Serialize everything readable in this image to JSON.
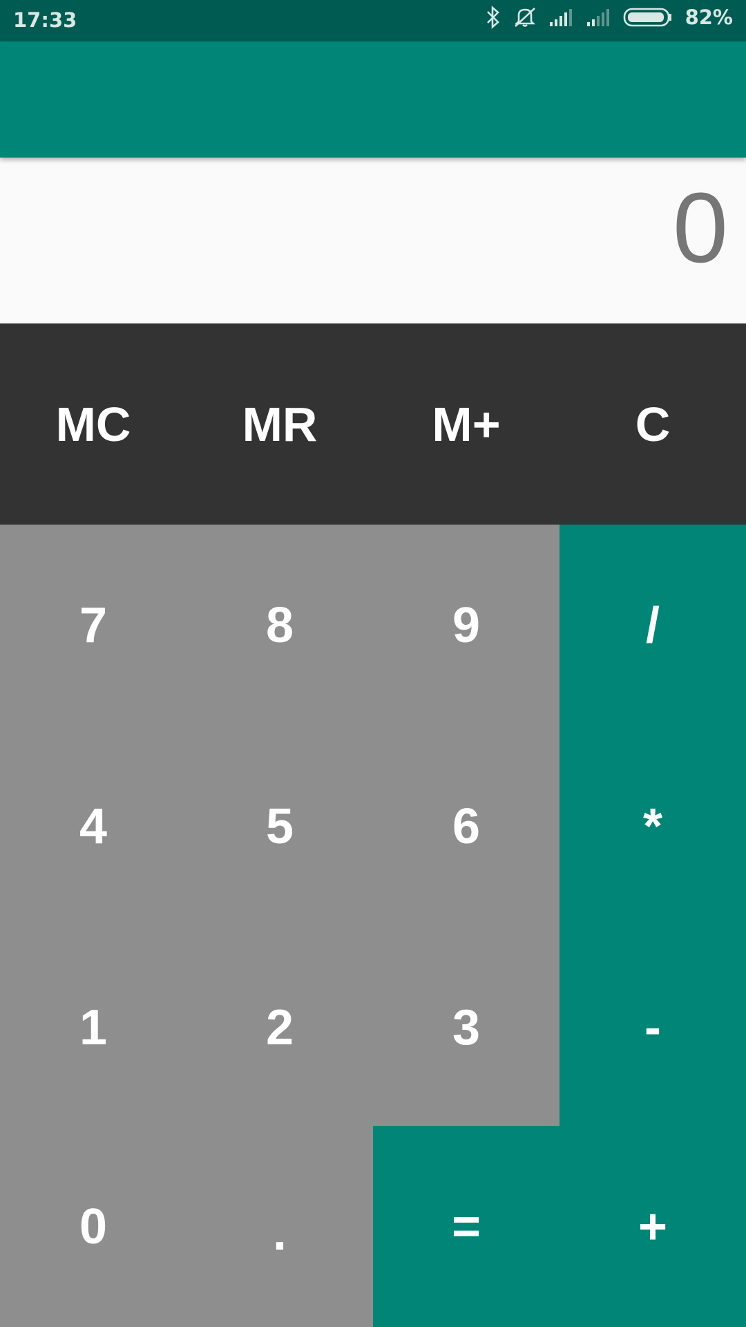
{
  "status_bar": {
    "time": "17:33",
    "battery_percent": "82%",
    "icons": [
      "bluetooth-icon",
      "vibrate-off-icon",
      "signal-icon",
      "signal-icon",
      "battery-icon"
    ]
  },
  "display": {
    "value": "0"
  },
  "memory_row": [
    {
      "label": "MC"
    },
    {
      "label": "MR"
    },
    {
      "label": "M+"
    },
    {
      "label": "C"
    }
  ],
  "keys": {
    "k7": "7",
    "k8": "8",
    "k9": "9",
    "div": "/",
    "k4": "4",
    "k5": "5",
    "k6": "6",
    "mul": "*",
    "k1": "1",
    "k2": "2",
    "k3": "3",
    "sub": "-",
    "k0": "0",
    "dot": ".",
    "eq": "=",
    "add": "+"
  },
  "colors": {
    "primary": "#008577",
    "primary_dark": "#005b52",
    "memory_bg": "#333333",
    "number_bg": "#8e8e8e",
    "display_bg": "#fafafa"
  }
}
